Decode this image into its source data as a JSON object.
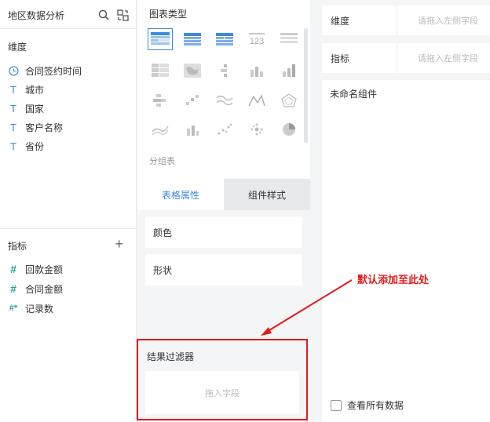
{
  "left_panel": {
    "title": "地区数据分析",
    "dimensions_label": "维度",
    "dimensions": [
      {
        "icon": "clock-icon",
        "name": "合同签约时间"
      },
      {
        "icon": "text-type-icon",
        "name": "城市"
      },
      {
        "icon": "text-type-icon",
        "name": "国家"
      },
      {
        "icon": "text-type-icon",
        "name": "客户名称"
      },
      {
        "icon": "text-type-icon",
        "name": "省份"
      }
    ],
    "metrics_label": "指标",
    "metrics": [
      {
        "icon": "hash-icon",
        "name": "回款金额"
      },
      {
        "icon": "hash-icon",
        "name": "合同金额"
      },
      {
        "icon": "hash-star-icon",
        "name": "记录数"
      }
    ],
    "type_glyph": "T",
    "hash_glyph": "#",
    "hash_star_glyph": "#*"
  },
  "config_panel": {
    "chart_type_title": "图表类型",
    "group_label": "分组表",
    "chart_number_glyph": "123",
    "tabs": [
      {
        "label": "表格属性",
        "active": true
      },
      {
        "label": "组件样式",
        "active": false
      }
    ],
    "properties": [
      "颜色",
      "形状"
    ],
    "filter_title": "结果过滤器",
    "filter_placeholder": "拖入字段"
  },
  "canvas": {
    "dimension_slot_label": "维度",
    "dimension_slot_placeholder": "请拖入左侧字段",
    "metric_slot_label": "指标",
    "metric_slot_placeholder": "请拖入左侧字段",
    "widget_title": "未命名组件",
    "show_all_label": "查看所有数据"
  },
  "annotation": {
    "text": "默认添加至此处",
    "color": "#e31b1b"
  },
  "colors": {
    "accent": "#3d8bd9",
    "metric_icon": "#22a39a"
  }
}
